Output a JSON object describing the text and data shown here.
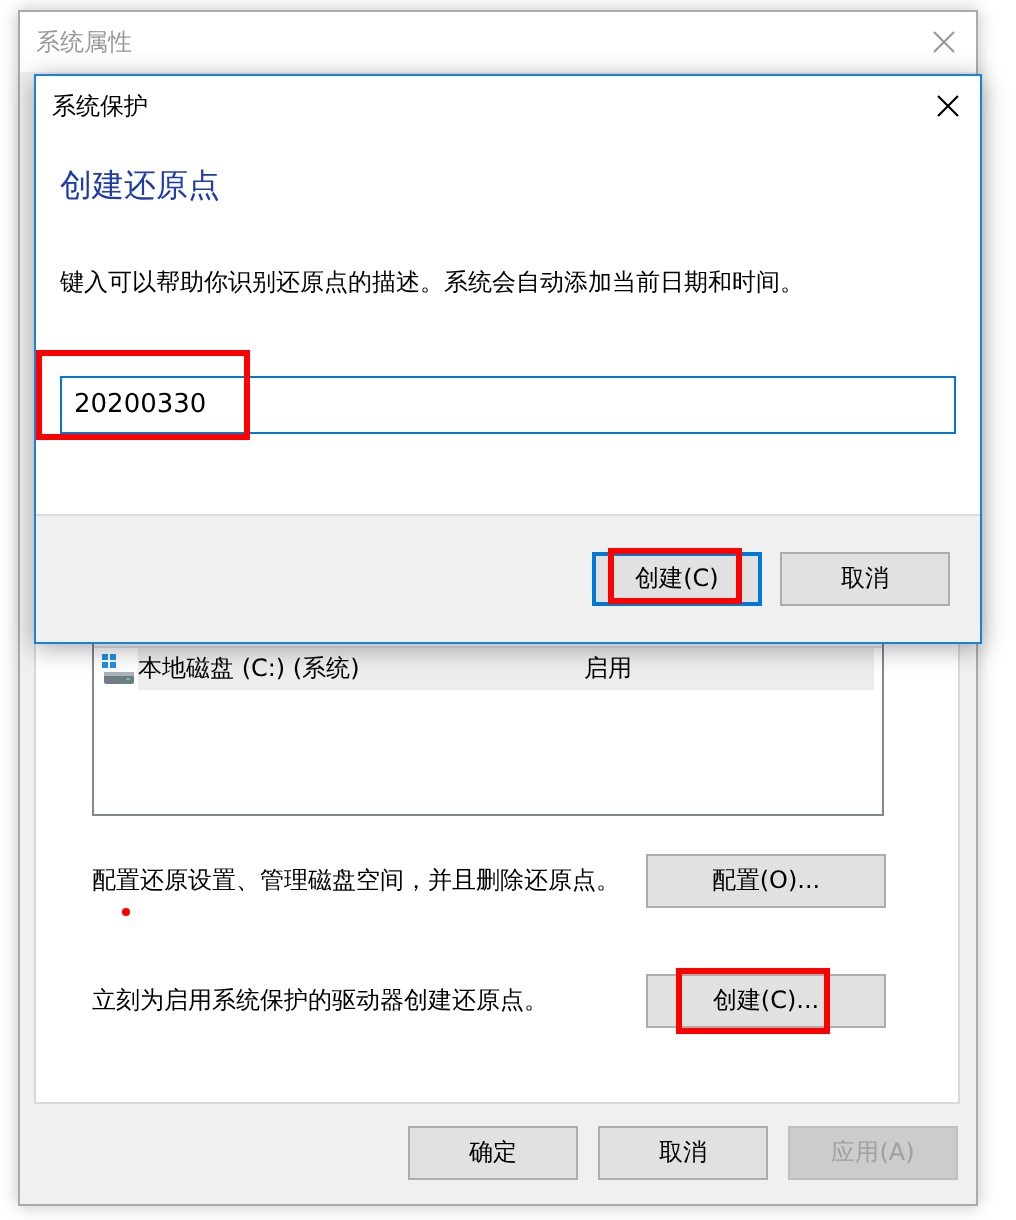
{
  "background_window": {
    "title": "系统属性",
    "drives": [
      {
        "name": "本地磁盘 (C:) (系统)",
        "protection": "启用",
        "selected": true
      }
    ],
    "actions": [
      {
        "description": "配置还原设置、管理磁盘空间，并且删除还原点。",
        "button": "配置(O)...",
        "highlighted": false,
        "marked": true
      },
      {
        "description": "立刻为启用系统保护的驱动器创建还原点。",
        "button": "创建(C)...",
        "highlighted": true,
        "marked": false
      }
    ],
    "buttons": [
      {
        "label": "确定",
        "disabled": false
      },
      {
        "label": "取消",
        "disabled": false
      },
      {
        "label": "应用(A)",
        "disabled": true
      }
    ]
  },
  "dialog": {
    "title": "系统保护",
    "heading": "创建还原点",
    "description": "键入可以帮助你识别还原点的描述。系统会自动添加当前日期和时间。",
    "field": {
      "value": "20200330",
      "highlighted": true
    },
    "buttons": [
      {
        "label": "创建(C)",
        "default": true,
        "highlighted": true
      },
      {
        "label": "取消",
        "default": false,
        "highlighted": false
      }
    ]
  }
}
